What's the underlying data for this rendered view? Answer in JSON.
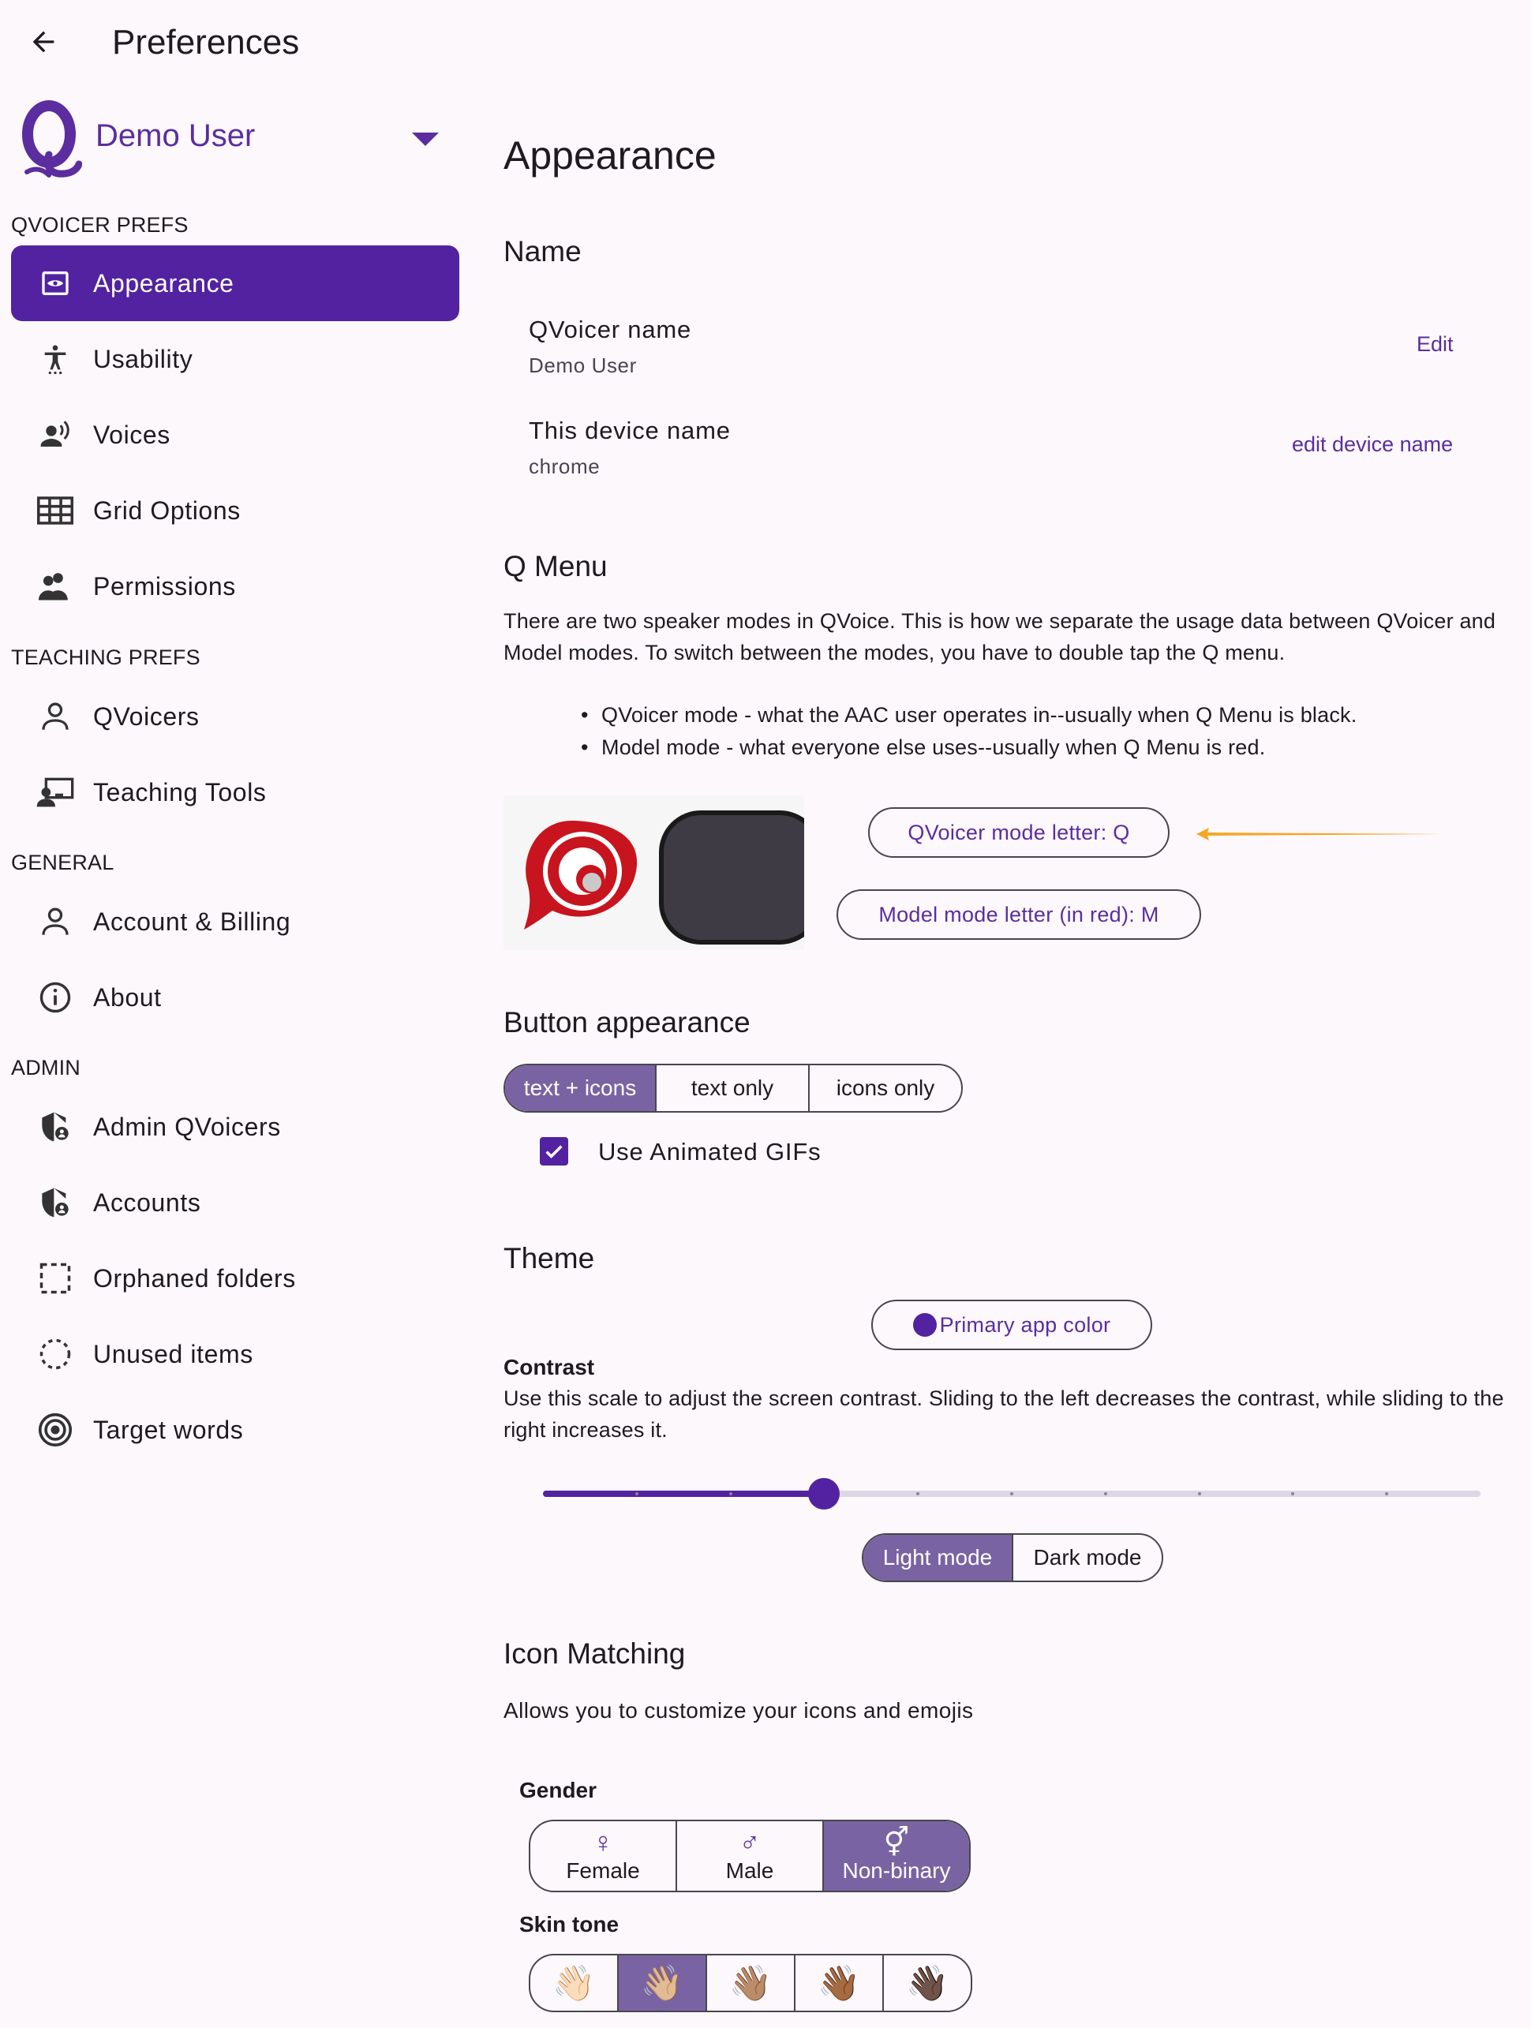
{
  "header": {
    "title": "Preferences"
  },
  "user": {
    "name": "Demo User"
  },
  "sidebar": {
    "sections": [
      {
        "title": "QVOICER PREFS",
        "items": [
          "Appearance",
          "Usability",
          "Voices",
          "Grid Options",
          "Permissions"
        ]
      },
      {
        "title": "TEACHING PREFS",
        "items": [
          "QVoicers",
          "Teaching Tools"
        ]
      },
      {
        "title": "GENERAL",
        "items": [
          "Account & Billing",
          "About"
        ]
      },
      {
        "title": "ADMIN",
        "items": [
          "Admin QVoicers",
          "Accounts",
          "Orphaned folders",
          "Unused items",
          "Target words"
        ]
      }
    ],
    "active": "Appearance"
  },
  "main": {
    "title": "Appearance",
    "name_section": {
      "heading": "Name",
      "qvoicer_label": "QVoicer name",
      "qvoicer_value": "Demo User",
      "qvoicer_action": "Edit",
      "device_label": "This device name",
      "device_value": "chrome",
      "device_action": "edit device name"
    },
    "qmenu": {
      "heading": "Q Menu",
      "paragraph": "There are two speaker modes in QVoice.  This is how we separate the usage data between QVoicer and Model modes.  To switch between the modes, you have to double tap the Q menu.",
      "bullets": [
        "QVoicer mode - what the AAC user operates in--usually when Q Menu is black.",
        "Model mode - what everyone else uses--usually when Q Menu is red."
      ],
      "qvoicer_letter_button": "QVoicer mode letter: Q",
      "model_letter_button": "Model mode letter (in red): M"
    },
    "button_appearance": {
      "heading": "Button appearance",
      "options": [
        "text + icons",
        "text only",
        "icons only"
      ],
      "selected": "text + icons",
      "animated_gifs_label": "Use Animated GIFs",
      "animated_gifs_checked": true
    },
    "theme": {
      "heading": "Theme",
      "primary_color_button": "Primary app color",
      "primary_color": "#5322a0",
      "contrast_label": "Contrast",
      "contrast_desc": "Use this scale to adjust the screen contrast. Sliding to the left decreases the contrast, while sliding to the right increases it.",
      "contrast_value": 3,
      "contrast_max": 10,
      "modes": [
        "Light mode",
        "Dark mode"
      ],
      "selected_mode": "Light mode"
    },
    "icon_matching": {
      "heading": "Icon Matching",
      "desc": "Allows you to customize your icons and emojis",
      "gender_label": "Gender",
      "genders": [
        "Female",
        "Male",
        "Non-binary"
      ],
      "gender_icons": [
        "♀",
        "♂",
        "⚥"
      ],
      "selected_gender": "Non-binary",
      "skin_label": "Skin tone",
      "skin_tones": [
        "👋🏻",
        "👋🏼",
        "👋🏽",
        "👋🏾",
        "👋🏿"
      ],
      "selected_skin_index": 1
    }
  },
  "colors": {
    "accent": "#5322a0",
    "link": "#5b2d9e",
    "selected_segment": "#7a63a2",
    "arrow": "#f5a623",
    "logo_red": "#c8141e"
  }
}
